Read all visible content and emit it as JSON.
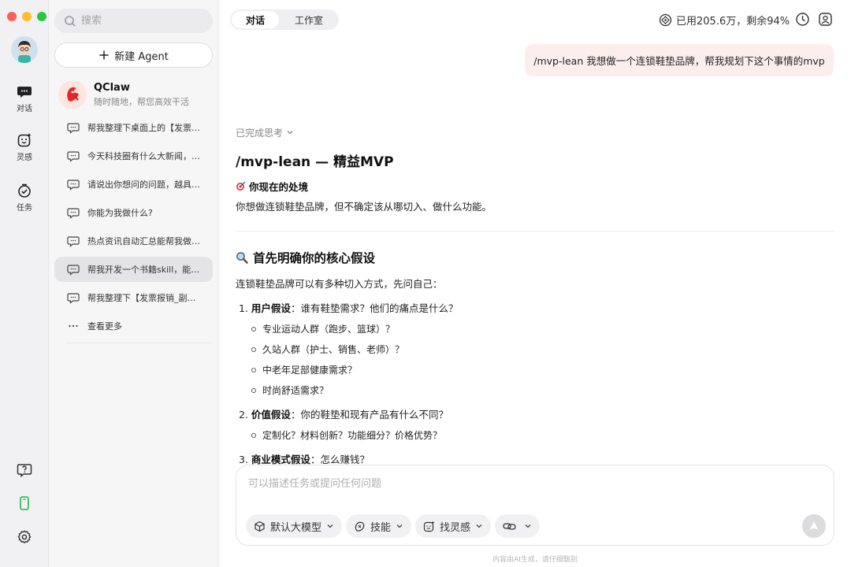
{
  "rail": {
    "items": [
      {
        "label": "对话"
      },
      {
        "label": "灵感"
      },
      {
        "label": "任务"
      }
    ]
  },
  "sidebar": {
    "search_placeholder": "搜索",
    "new_agent_label": "新建 Agent",
    "agent": {
      "name": "QClaw",
      "subtitle": "随时随地，帮您高效干活"
    },
    "chats": [
      {
        "title": "帮我整理下桌面上的【发票报销_副本】"
      },
      {
        "title": "今天科技圈有什么大新闻，帮我总结"
      },
      {
        "title": "请说出你想问的问题，越具体越好"
      },
      {
        "title": "你能为我做什么?"
      },
      {
        "title": "热点资讯自动汇总能帮我做什么"
      },
      {
        "title": "帮我开发一个书籍skill，能自动推荐"
      },
      {
        "title": "帮我整理下【发票报销_副本】文件"
      }
    ],
    "more_label": "查看更多"
  },
  "header": {
    "tabs": [
      {
        "label": "对话"
      },
      {
        "label": "工作室"
      }
    ],
    "usage_text": "已用205.6万，剩余94%"
  },
  "conversation": {
    "user_message": "/mvp-lean 我想做一个连锁鞋垫品牌，帮我规划下这个事情的mvp",
    "thinking_label": "已完成思考",
    "title": "/mvp-lean — 精益MVP",
    "situation_heading": "你现在的处境",
    "situation_text": "你想做连锁鞋垫品牌，但不确定该从哪切入、做什么功能。",
    "section_heading": "首先明确你的核心假设",
    "section_intro": "连锁鞋垫品牌可以有多种切入方式，先问自己：",
    "assumptions": [
      {
        "num": "1.",
        "title": "用户假设",
        "question": "：谁有鞋垫需求？他们的痛点是什么？",
        "bullets": [
          "专业运动人群（跑步、篮球）？",
          "久站人群（护士、销售、老师）？",
          "中老年足部健康需求？",
          "时尚舒适需求？"
        ]
      },
      {
        "num": "2.",
        "title": "价值假设",
        "question": "：你的鞋垫和现有产品有什么不同？",
        "bullets": [
          "定制化？材料创新？功能细分？价格优势？"
        ]
      },
      {
        "num": "3.",
        "title": "商业模式假设",
        "question": "：怎么赚钱？",
        "bullets": []
      }
    ]
  },
  "composer": {
    "placeholder": "可以描述任务或提问任何问题",
    "model_label": "默认大模型",
    "skills_label": "技能",
    "inspire_label": "找灵感"
  },
  "disclaimer": "内容由AI生成，请仔细甄别"
}
